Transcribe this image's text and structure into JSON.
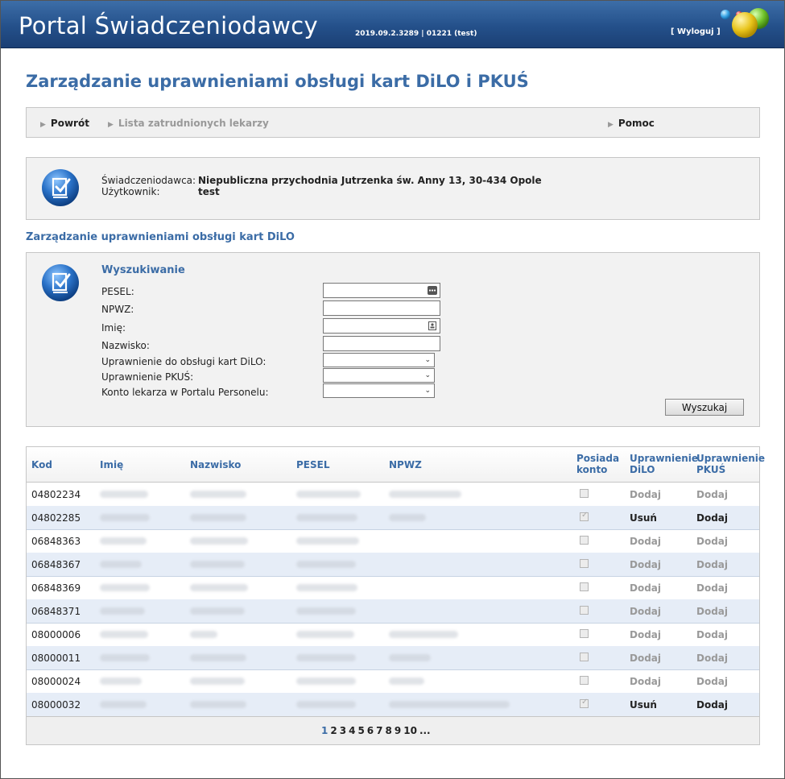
{
  "header": {
    "title": "Portal Świadczeniodawcy",
    "version": "2019.09.2.3289 | 01221 (test)",
    "logout": "[ Wyloguj ]"
  },
  "page_title": "Zarządzanie uprawnieniami obsługi kart DiLO i PKUŚ",
  "nav": {
    "back": "Powrót",
    "doctors": "Lista zatrudnionych lekarzy",
    "help": "Pomoc"
  },
  "info": {
    "provider_label": "Świadczeniodawca:",
    "provider_value": "Niepubliczna przychodnia Jutrzenka św. Anny 13, 30-434 Opole",
    "user_label": "Użytkownik:",
    "user_value": "test"
  },
  "section_title": "Zarządzanie uprawnieniami obsługi kart DiLO",
  "search": {
    "title": "Wyszukiwanie",
    "pesel": "PESEL:",
    "npwz": "NPWZ:",
    "imie": "Imię:",
    "nazwisko": "Nazwisko:",
    "dilo": "Uprawnienie do obsługi kart DiLO:",
    "pkus": "Uprawnienie PKUŚ:",
    "konto": "Konto lekarza w Portalu Personelu:",
    "button": "Wyszukaj"
  },
  "table": {
    "headers": {
      "kod": "Kod",
      "imie": "Imię",
      "nazwisko": "Nazwisko",
      "pesel": "PESEL",
      "npwz": "NPWZ",
      "konto": [
        "Posiada",
        "konto"
      ],
      "dilo": [
        "Uprawnienie",
        "DiLO"
      ],
      "pkus": [
        "Uprawnienie",
        "PKUŚ"
      ]
    },
    "rows": [
      {
        "kod": "04802234",
        "checked": false,
        "dilo": "Dodaj",
        "dilo_active": false,
        "pkus": "Dodaj",
        "pkus_active": false
      },
      {
        "kod": "04802285",
        "checked": true,
        "dilo": "Usuń",
        "dilo_active": true,
        "pkus": "Dodaj",
        "pkus_active": true
      },
      {
        "kod": "06848363",
        "checked": false,
        "dilo": "Dodaj",
        "dilo_active": false,
        "pkus": "Dodaj",
        "pkus_active": false
      },
      {
        "kod": "06848367",
        "checked": false,
        "dilo": "Dodaj",
        "dilo_active": false,
        "pkus": "Dodaj",
        "pkus_active": false
      },
      {
        "kod": "06848369",
        "checked": false,
        "dilo": "Dodaj",
        "dilo_active": false,
        "pkus": "Dodaj",
        "pkus_active": false
      },
      {
        "kod": "06848371",
        "checked": false,
        "dilo": "Dodaj",
        "dilo_active": false,
        "pkus": "Dodaj",
        "pkus_active": false
      },
      {
        "kod": "08000006",
        "checked": false,
        "dilo": "Dodaj",
        "dilo_active": false,
        "pkus": "Dodaj",
        "pkus_active": false
      },
      {
        "kod": "08000011",
        "checked": false,
        "dilo": "Dodaj",
        "dilo_active": false,
        "pkus": "Dodaj",
        "pkus_active": false
      },
      {
        "kod": "08000024",
        "checked": false,
        "dilo": "Dodaj",
        "dilo_active": false,
        "pkus": "Dodaj",
        "pkus_active": false
      },
      {
        "kod": "08000032",
        "checked": true,
        "dilo": "Usuń",
        "dilo_active": true,
        "pkus": "Dodaj",
        "pkus_active": true
      }
    ]
  },
  "pager": {
    "pages": [
      "1",
      "2",
      "3",
      "4",
      "5",
      "6",
      "7",
      "8",
      "9",
      "10",
      "..."
    ],
    "current": "1"
  },
  "colors": {
    "header_blue": "#24508a",
    "title_blue": "#3b6ca6",
    "row_alt": "#e6edf7"
  }
}
